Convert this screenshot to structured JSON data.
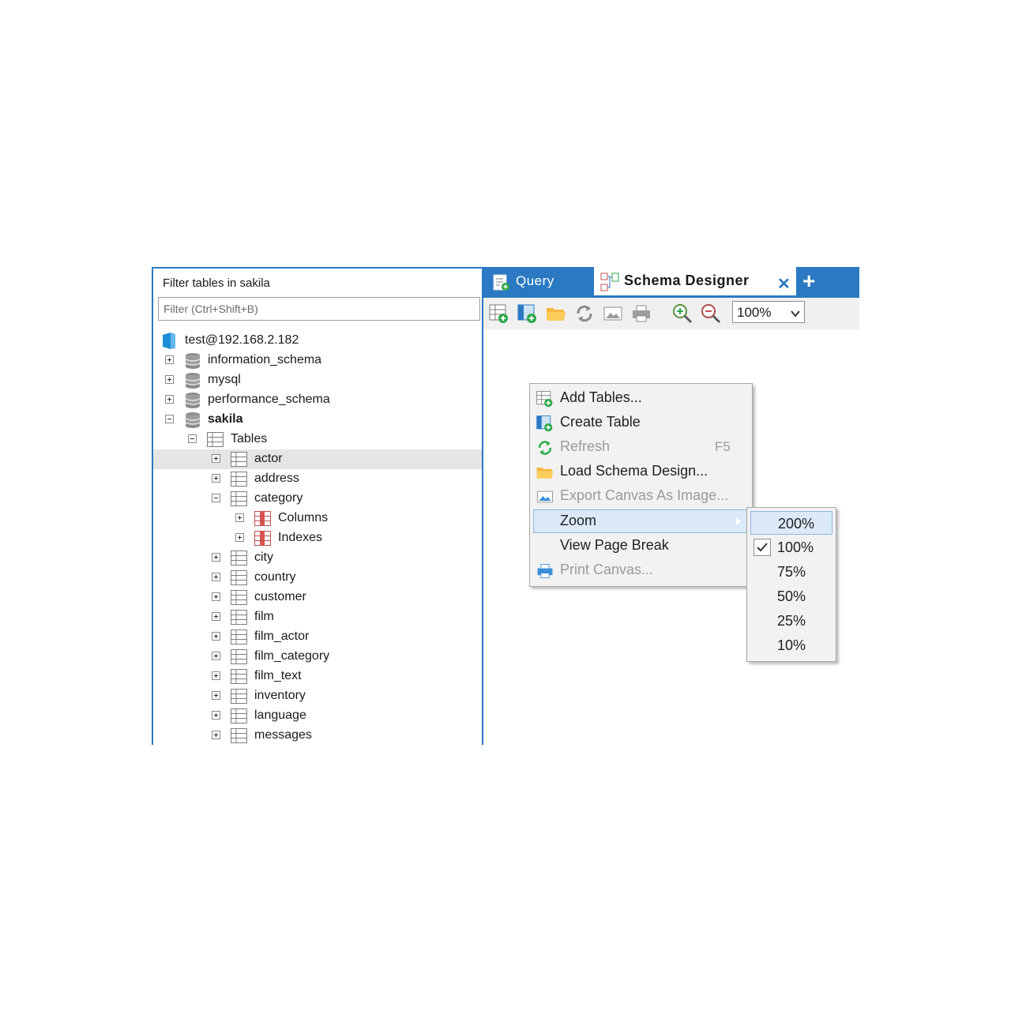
{
  "sidebar": {
    "filter_title": "Filter tables in sakila",
    "filter_placeholder": "Filter (Ctrl+Shift+B)",
    "connection": "test@192.168.2.182",
    "databases": [
      "information_schema",
      "mysql",
      "performance_schema"
    ],
    "active_db": "sakila",
    "tables_label": "Tables",
    "tables": [
      "actor",
      "address",
      "category",
      "city",
      "country",
      "customer",
      "film",
      "film_actor",
      "film_category",
      "film_text",
      "inventory",
      "language",
      "messages"
    ],
    "category_children": [
      "Columns",
      "Indexes"
    ],
    "selected_table": "actor"
  },
  "tabs": {
    "query_label": "Query",
    "schema_label": "Schema Designer",
    "close_glyph": "✕",
    "add_glyph": "+"
  },
  "toolbar": {
    "zoom_value": "100%",
    "icons": [
      "add-tables-icon",
      "create-table-icon",
      "open-folder-icon",
      "refresh-icon",
      "export-image-icon",
      "print-icon",
      "zoom-in-icon",
      "zoom-out-icon"
    ]
  },
  "context_menu": {
    "items": [
      {
        "label": "Add Tables...",
        "icon": "add-tables-icon",
        "disabled": false
      },
      {
        "label": "Create Table",
        "icon": "create-table-icon",
        "disabled": false
      },
      {
        "label": "Refresh",
        "icon": "refresh-icon",
        "disabled": true,
        "shortcut": "F5"
      },
      {
        "label": "Load Schema Design...",
        "icon": "folder-icon",
        "disabled": false
      },
      {
        "label": "Export Canvas As Image...",
        "icon": "export-image-icon",
        "disabled": true
      },
      {
        "label": "Zoom",
        "icon": "",
        "disabled": false,
        "submenu": true
      },
      {
        "label": "View Page Break",
        "icon": "",
        "disabled": false
      },
      {
        "label": "Print Canvas...",
        "icon": "print-icon",
        "disabled": true
      }
    ]
  },
  "zoom_menu": {
    "options": [
      "200%",
      "100%",
      "75%",
      "50%",
      "25%",
      "10%"
    ],
    "highlighted": "200%",
    "checked": "100%"
  },
  "colors": {
    "accent": "#2b79c2",
    "highlight": "#dbe9f8",
    "disabled_text": "#9a9a9a"
  }
}
